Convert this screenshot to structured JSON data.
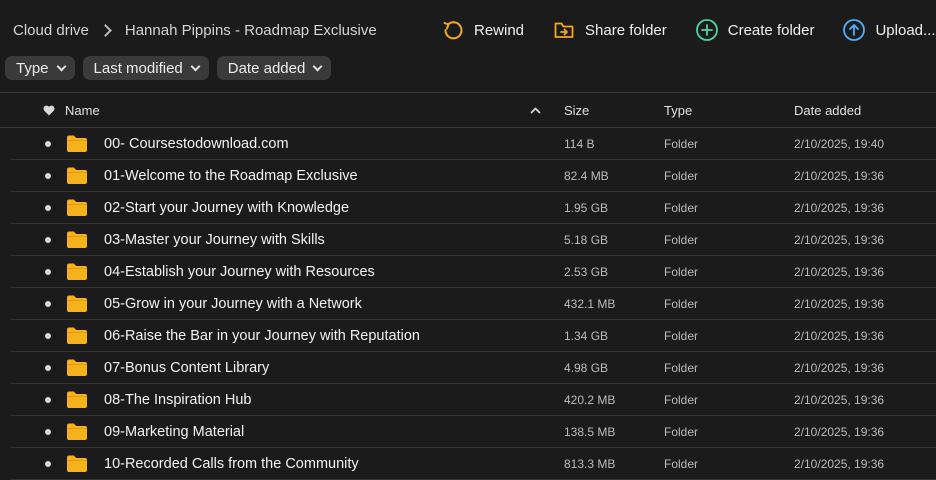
{
  "breadcrumb": {
    "root": "Cloud drive",
    "current": "Hannah Pippins - Roadmap Exclusive"
  },
  "actions": [
    {
      "label": "Rewind",
      "icon": "rewind-icon",
      "color": "#f5a623"
    },
    {
      "label": "Share folder",
      "icon": "share-folder-icon",
      "color": "#f5a623"
    },
    {
      "label": "Create folder",
      "icon": "create-folder-icon",
      "color": "#4fd1a5"
    },
    {
      "label": "Upload...",
      "icon": "upload-icon",
      "color": "#4ab0ff"
    }
  ],
  "filters": [
    {
      "label": "Type"
    },
    {
      "label": "Last modified"
    },
    {
      "label": "Date added"
    }
  ],
  "columns": {
    "name": "Name",
    "size": "Size",
    "type": "Type",
    "date_added": "Date added"
  },
  "rows": [
    {
      "name": "00- Coursestodownload.com",
      "size": "114 B",
      "type": "Folder",
      "date": "2/10/2025, 19:40"
    },
    {
      "name": "01-Welcome to the Roadmap Exclusive",
      "size": "82.4 MB",
      "type": "Folder",
      "date": "2/10/2025, 19:36"
    },
    {
      "name": "02-Start your Journey with Knowledge",
      "size": "1.95 GB",
      "type": "Folder",
      "date": "2/10/2025, 19:36"
    },
    {
      "name": "03-Master your Journey with Skills",
      "size": "5.18 GB",
      "type": "Folder",
      "date": "2/10/2025, 19:36"
    },
    {
      "name": "04-Establish your Journey with Resources",
      "size": "2.53 GB",
      "type": "Folder",
      "date": "2/10/2025, 19:36"
    },
    {
      "name": "05-Grow in your Journey with a Network",
      "size": "432.1 MB",
      "type": "Folder",
      "date": "2/10/2025, 19:36"
    },
    {
      "name": "06-Raise the Bar in your Journey with Reputation",
      "size": "1.34 GB",
      "type": "Folder",
      "date": "2/10/2025, 19:36"
    },
    {
      "name": "07-Bonus Content Library",
      "size": "4.98 GB",
      "type": "Folder",
      "date": "2/10/2025, 19:36"
    },
    {
      "name": "08-The Inspiration Hub",
      "size": "420.2 MB",
      "type": "Folder",
      "date": "2/10/2025, 19:36"
    },
    {
      "name": "09-Marketing Material",
      "size": "138.5 MB",
      "type": "Folder",
      "date": "2/10/2025, 19:36"
    },
    {
      "name": "10-Recorded Calls from the Community",
      "size": "813.3 MB",
      "type": "Folder",
      "date": "2/10/2025, 19:36"
    }
  ],
  "colors": {
    "folder": "#f7b21b",
    "background": "#1b1b1b"
  }
}
